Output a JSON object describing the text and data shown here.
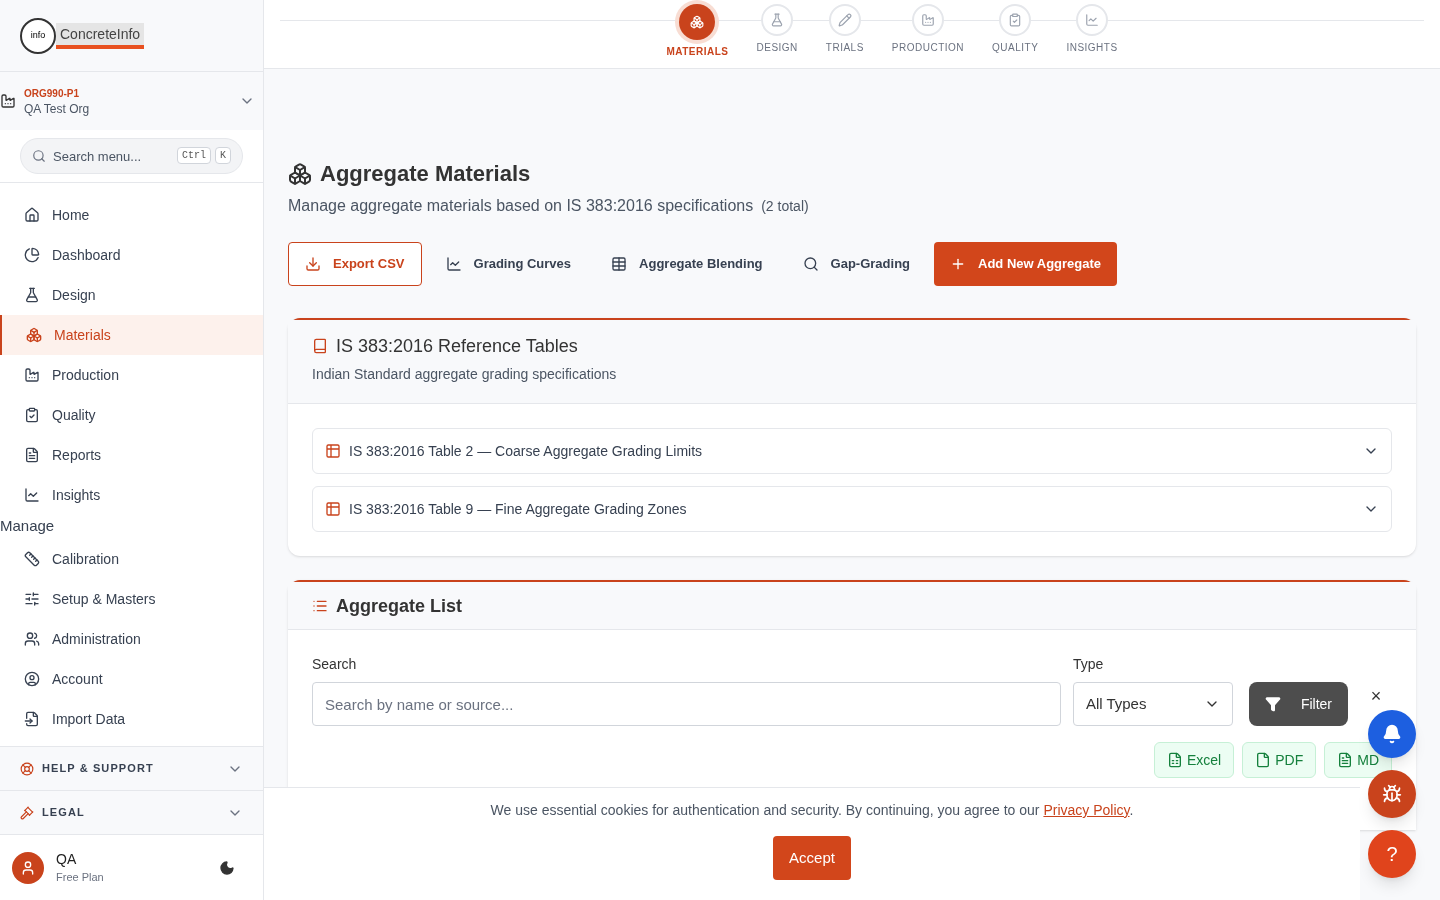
{
  "brand": {
    "name": "ConcreteInfo",
    "mark": "info"
  },
  "org": {
    "code": "ORG990-P1",
    "name": "QA Test Org"
  },
  "menu_search": {
    "placeholder": "Search menu...",
    "keys": [
      "Ctrl",
      "K"
    ]
  },
  "nav": [
    {
      "label": "Home",
      "selected": false
    },
    {
      "label": "Dashboard",
      "selected": false
    },
    {
      "label": "Design",
      "selected": false
    },
    {
      "label": "Materials",
      "selected": true
    },
    {
      "label": "Production",
      "selected": false
    },
    {
      "label": "Quality",
      "selected": false
    },
    {
      "label": "Reports",
      "selected": false
    },
    {
      "label": "Insights",
      "selected": false
    }
  ],
  "manage_heading": "Manage",
  "manage": [
    {
      "label": "Calibration",
      "selected": false
    },
    {
      "label": "Setup & Masters",
      "selected": false
    },
    {
      "label": "Administration",
      "selected": false
    },
    {
      "label": "Account",
      "selected": false
    },
    {
      "label": "Import Data",
      "selected": false
    }
  ],
  "sections": [
    {
      "label": "HELP & SUPPORT",
      "expanded": false
    },
    {
      "label": "LEGAL",
      "expanded": false
    }
  ],
  "user": {
    "name": "QA",
    "plan": "Free Plan"
  },
  "steps": [
    {
      "label": "MATERIALS",
      "selected": true
    },
    {
      "label": "DESIGN",
      "selected": false
    },
    {
      "label": "TRIALS",
      "selected": false
    },
    {
      "label": "PRODUCTION",
      "selected": false
    },
    {
      "label": "QUALITY",
      "selected": false
    },
    {
      "label": "INSIGHTS",
      "selected": false
    }
  ],
  "page": {
    "title": "Aggregate Materials",
    "subtitle": "Manage aggregate materials based on IS 383:2016 specifications",
    "count": "(2 total)"
  },
  "actions": [
    {
      "label": "Export CSV",
      "kind": "outline"
    },
    {
      "label": "Grading Curves",
      "kind": "plain"
    },
    {
      "label": "Aggregate Blending",
      "kind": "plain"
    },
    {
      "label": "Gap-Grading",
      "kind": "plain"
    },
    {
      "label": "Add New Aggregate",
      "kind": "primary"
    }
  ],
  "reference": {
    "title": "IS 383:2016 Reference Tables",
    "subtitle": "Indian Standard aggregate grading specifications",
    "tables": [
      {
        "label": "IS 383:2016 Table 2 — Coarse Aggregate Grading Limits",
        "expanded": false
      },
      {
        "label": "IS 383:2016 Table 9 — Fine Aggregate Grading Zones",
        "expanded": false
      }
    ]
  },
  "list": {
    "title": "Aggregate List",
    "search_label": "Search",
    "search_placeholder": "Search by name or source...",
    "type_label": "Type",
    "type_value": "All Types",
    "filter": "Filter",
    "clear": "×",
    "exports": [
      "Excel",
      "PDF",
      "MD"
    ]
  },
  "cookie": {
    "text": "We use essential cookies for authentication and security. By continuing, you agree to our ",
    "link": "Privacy Policy",
    "end": ".",
    "button": "Accept"
  },
  "help_button": "?"
}
